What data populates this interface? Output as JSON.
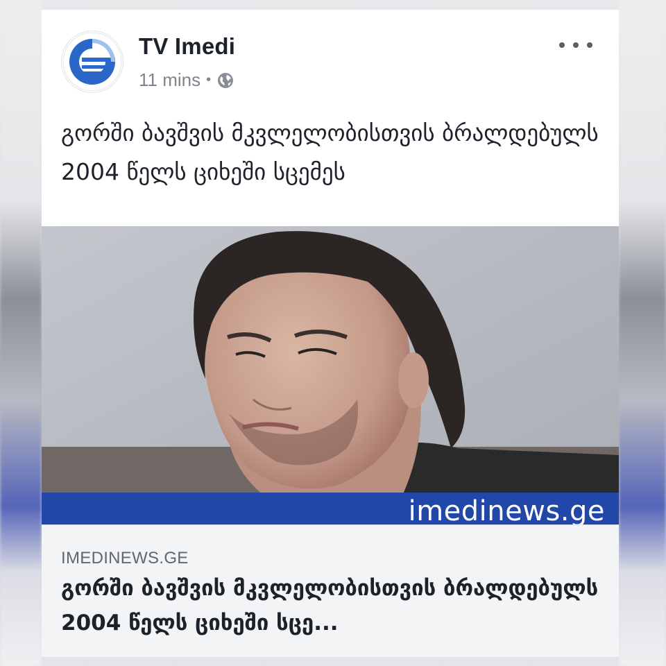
{
  "post": {
    "page_name": "TV Imedi",
    "time": "11 mins",
    "separator": "•",
    "privacy_icon": "globe-icon",
    "more_icon": "more-options-icon",
    "text": "გორში ბავშვის მკვლელობისთვის ბრალდებულს 2004 წელს ციხეში სცემეს"
  },
  "link_preview": {
    "image_watermark": "imedinews.ge",
    "domain": "IMEDINEWS.GE",
    "title": "გორში ბავშვის მკვლელობისთვის ბრალდებულს 2004 წელს ციხეში სცე..."
  },
  "colors": {
    "watermark_bar": "#2147a8",
    "logo_blue": "#2a67c9",
    "text_primary": "#1d2129",
    "text_secondary": "#606770"
  }
}
